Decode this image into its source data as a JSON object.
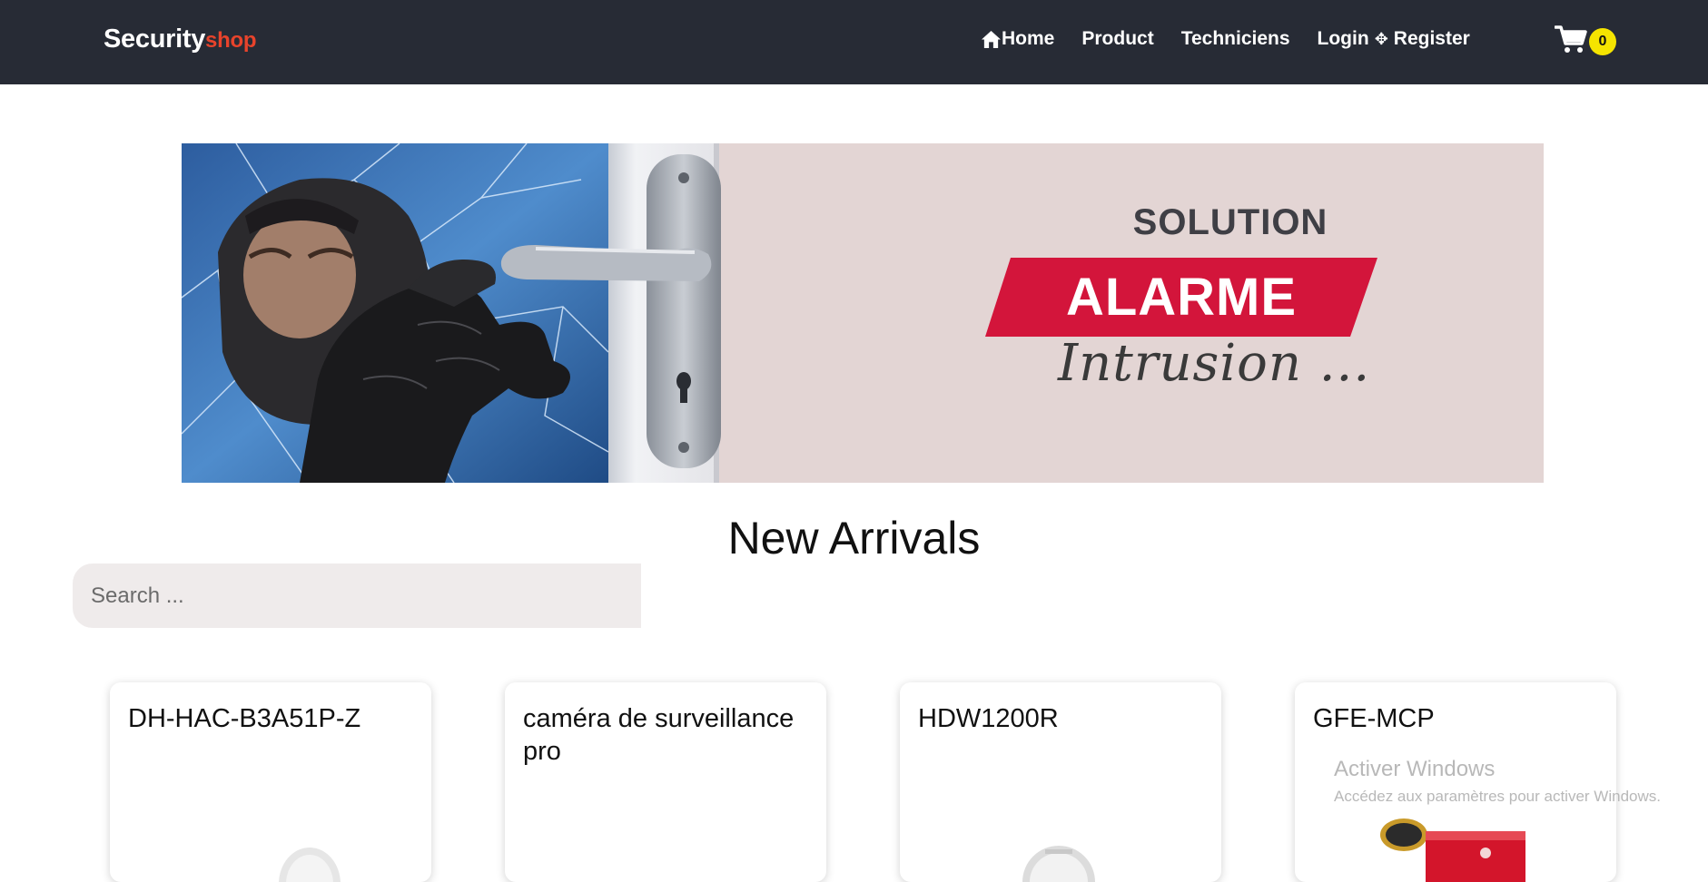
{
  "brand": {
    "main": "Security",
    "accent": "shop"
  },
  "nav": {
    "home": "Home",
    "product": "Product",
    "techniciens": "Techniciens",
    "login": "Login",
    "separator": "✥",
    "register": "Register"
  },
  "cart": {
    "count": "0"
  },
  "banner": {
    "solution": "SOLUTION",
    "alarme": "ALARME",
    "intrusion": "Intrusion ..."
  },
  "main": {
    "section_title": "New Arrivals",
    "search_placeholder": "Search ..."
  },
  "products": [
    {
      "name": "DH-HAC-B3A51P-Z"
    },
    {
      "name": "caméra de surveillance pro"
    },
    {
      "name": "HDW1200R"
    },
    {
      "name": "GFE-MCP"
    }
  ],
  "watermark": {
    "title": "Activer Windows",
    "subtitle": "Accédez aux paramètres pour activer Windows."
  },
  "colors": {
    "navbar_bg": "#272b35",
    "brand_accent": "#e8432b",
    "badge": "#f5e400",
    "alarme_red": "#d3153b",
    "banner_bg": "#e3d5d4"
  }
}
